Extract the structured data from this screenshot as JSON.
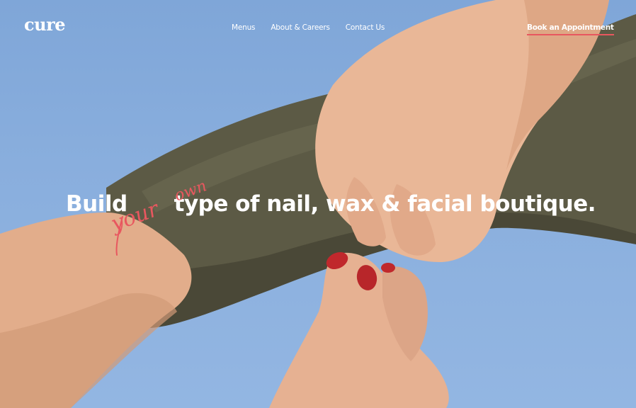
{
  "brand": {
    "logo_text": "cure"
  },
  "nav": {
    "items": [
      {
        "label": "Menus"
      },
      {
        "label": "About & Careers"
      },
      {
        "label": "Contact Us"
      }
    ],
    "cta_label": "Book an Appointment"
  },
  "hero": {
    "headline_start": "Build",
    "script_word_1": "your",
    "script_word_2": "own",
    "headline_end": "type of nail, wax & facial boutique."
  },
  "colors": {
    "sky": "#89aedd",
    "fabric": "#5c5a45",
    "skin": "#e7b594",
    "accent": "#e8575f",
    "nail_polish": "#c0282c"
  }
}
